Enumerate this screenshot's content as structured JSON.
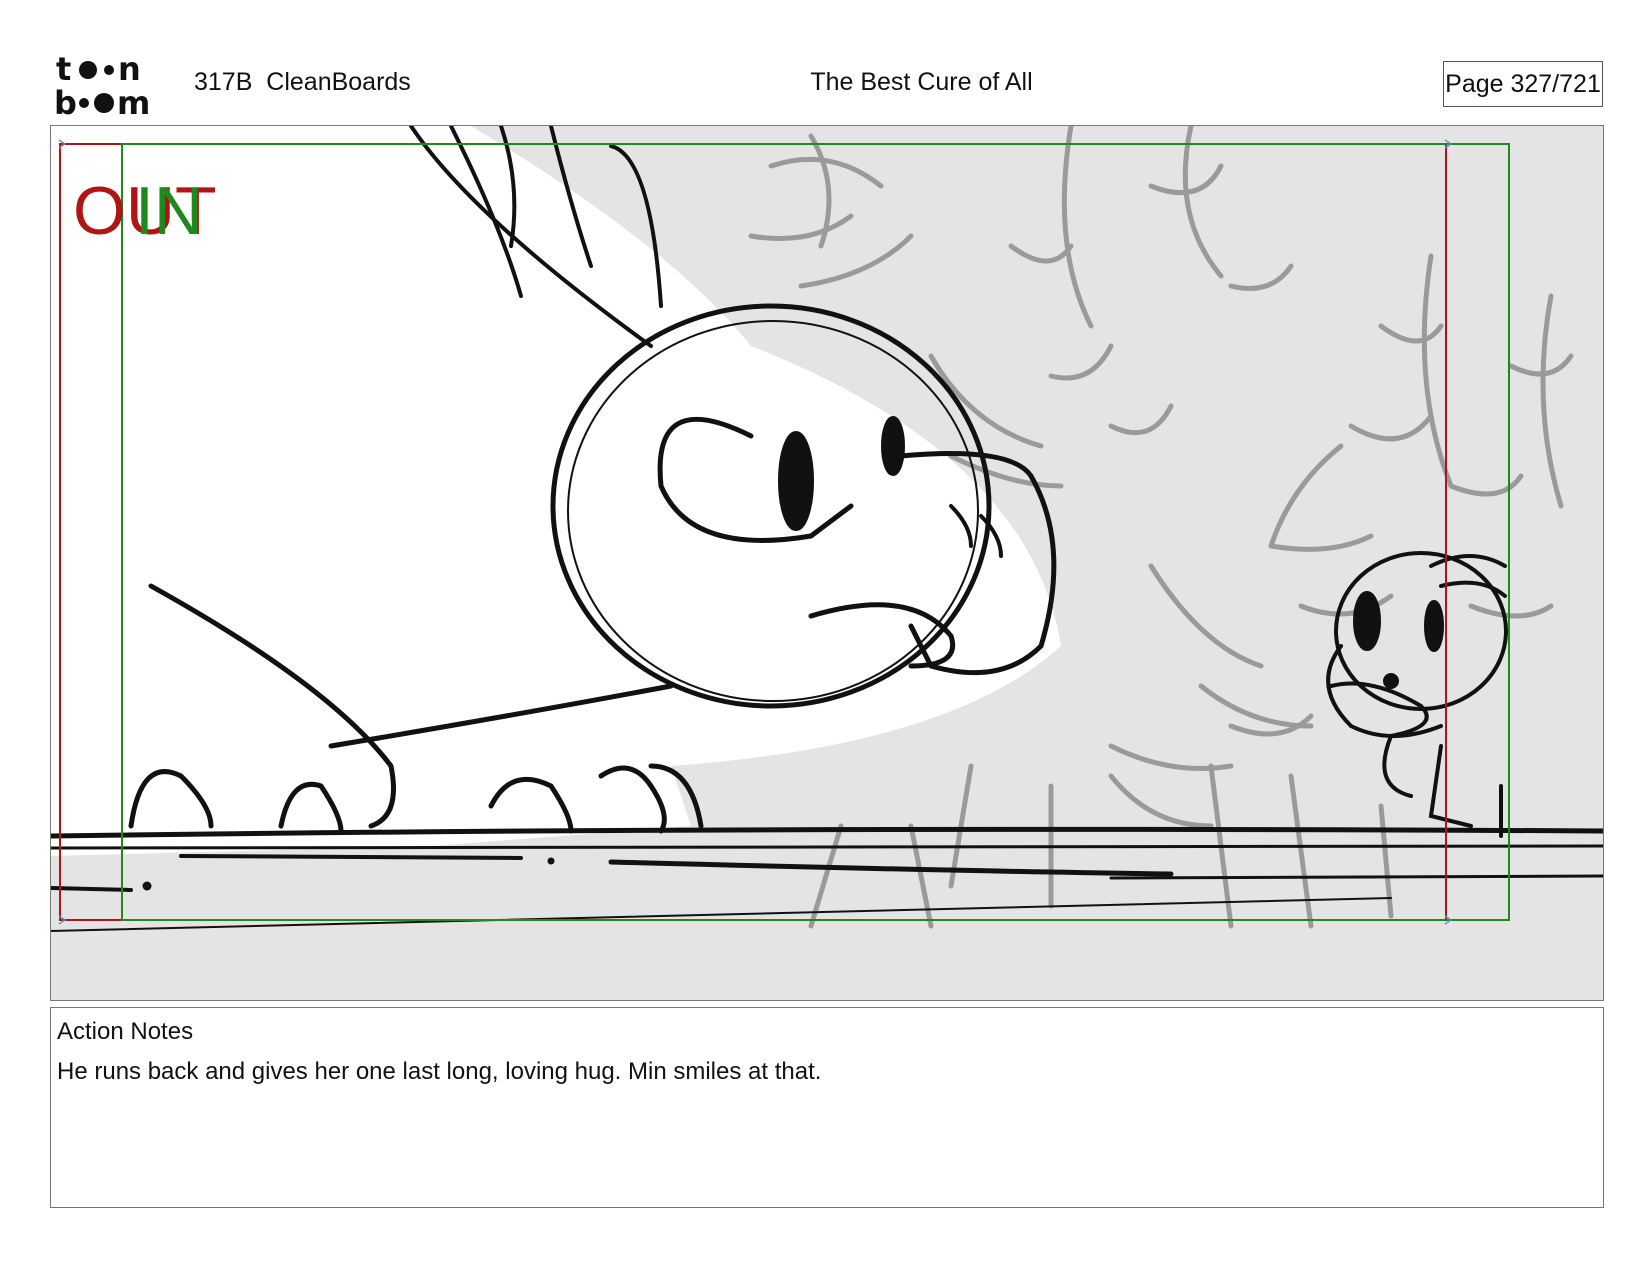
{
  "header": {
    "logo_text": "toon boom",
    "project": "317B  CleanBoards",
    "title": "The Best Cure of All",
    "page": "Page 327/721"
  },
  "panel": {
    "transition_out": "OUT",
    "transition_in": "IN",
    "colors": {
      "out": "#b01515",
      "in": "#1e8a1e",
      "bg_gray": "#e4e4e4",
      "tree": "#9a9a9a",
      "ink": "#111111"
    }
  },
  "notes": {
    "heading": "Action Notes",
    "text": "He runs back and gives her one last long, loving hug. Min smiles at that."
  }
}
